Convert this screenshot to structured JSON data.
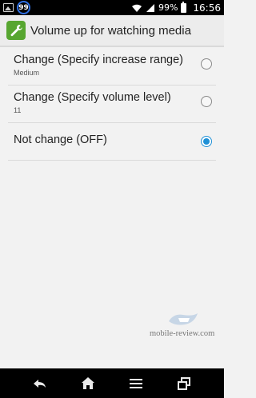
{
  "status_bar": {
    "notification_badge": "99",
    "battery_percent": "99%",
    "time": "16:56"
  },
  "action_bar": {
    "title": "Volume up for watching media",
    "icon": "wrench-icon",
    "icon_color": "#57a630"
  },
  "options": [
    {
      "title": "Change (Specify increase range)",
      "subtitle": "Medium",
      "selected": false
    },
    {
      "title": "Change (Specify volume level)",
      "subtitle": "11",
      "selected": false
    },
    {
      "title": "Not change (OFF)",
      "subtitle": "",
      "selected": true
    }
  ],
  "watermark": {
    "text": "mobile-review.com"
  },
  "nav_bar": {
    "buttons": [
      "back-icon",
      "home-icon",
      "menu-icon",
      "recent-apps-icon"
    ]
  },
  "colors": {
    "accent": "#1e90d6",
    "background": "#f2f2f2"
  }
}
